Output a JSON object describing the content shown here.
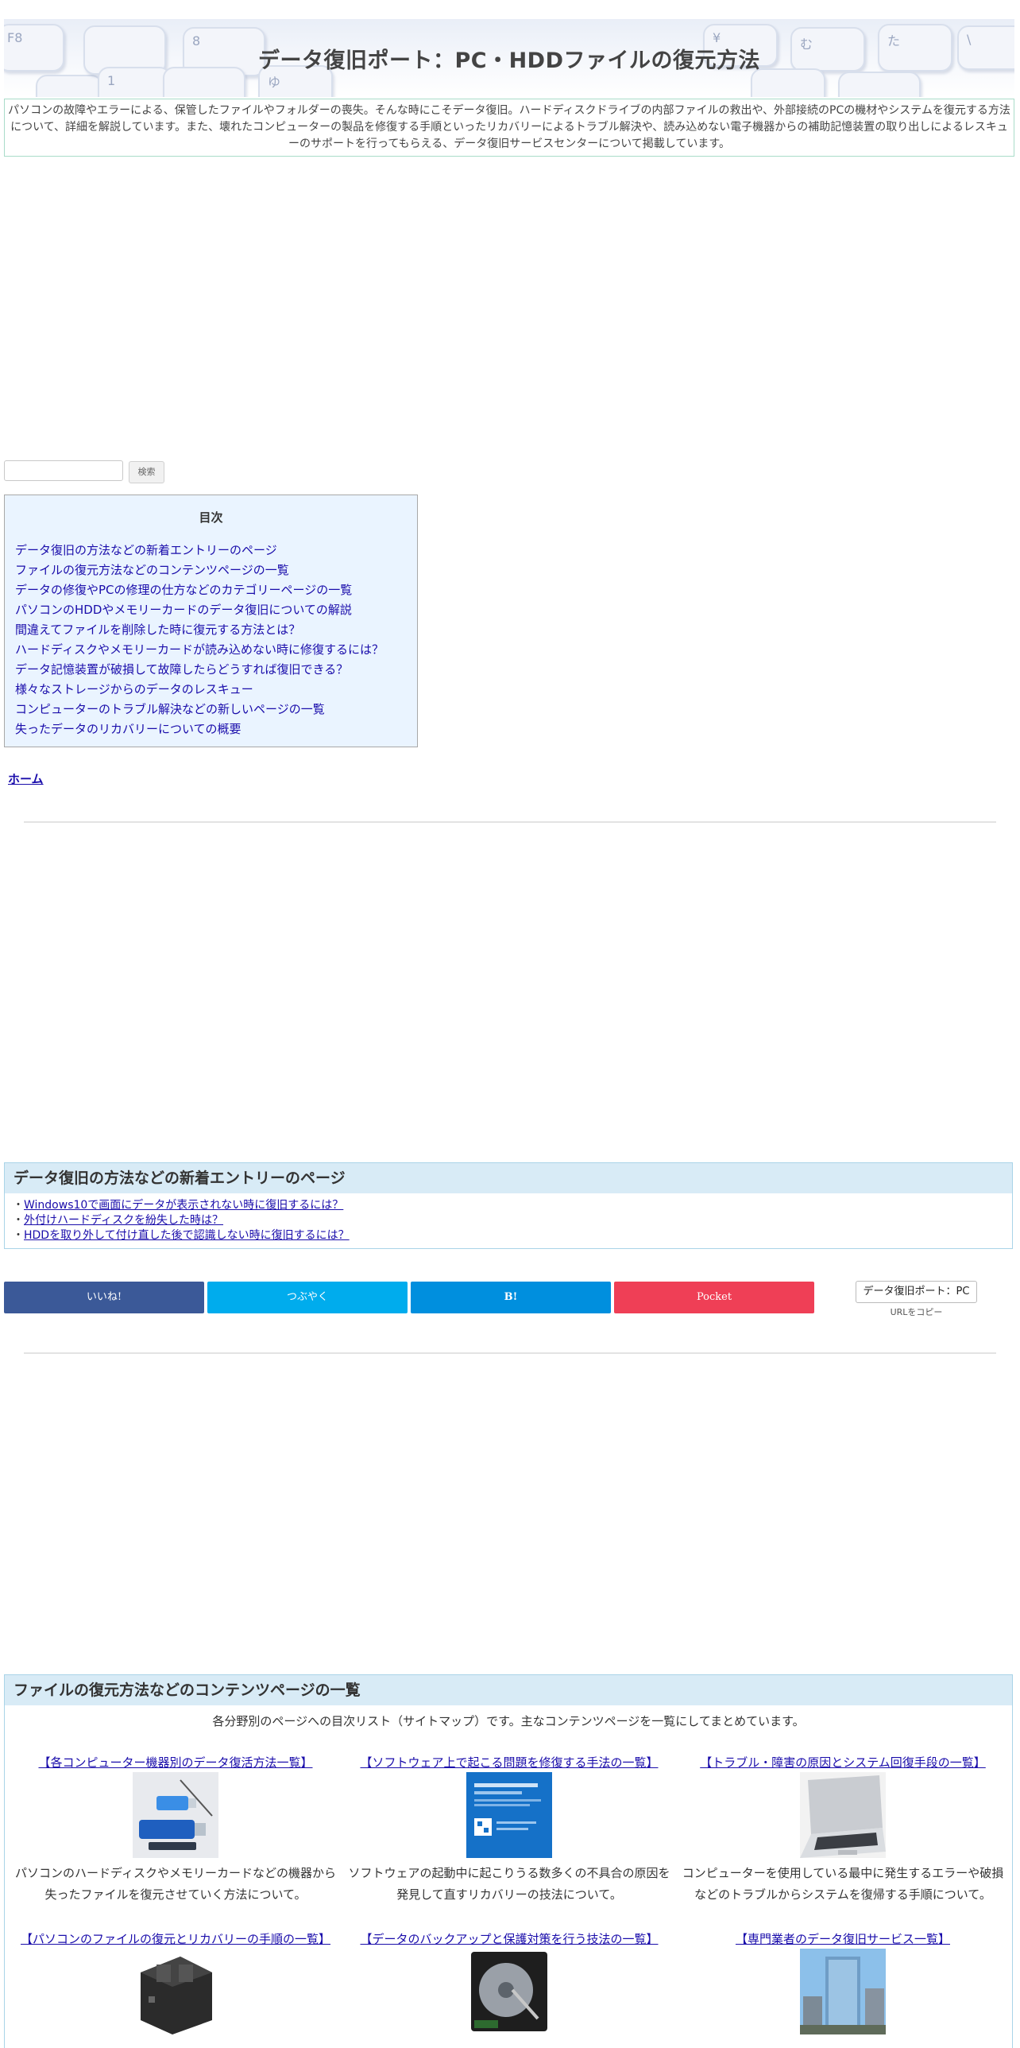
{
  "header": {
    "site_title": "データ復旧ポート：PC・HDDファイルの復元方法",
    "description": "パソコンの故障やエラーによる、保管したファイルやフォルダーの喪失。そんな時にこそデータ復旧。ハードディスクドライブの内部ファイルの救出や、外部接続のPCの機材やシステムを復元する方法について、詳細を解説しています。また、壊れたコンピューターの製品を修復する手順といったリカバリーによるトラブル解決や、読み込めない電子機器からの補助記憶装置の取り出しによるレスキューのサポートを行ってもらえる、データ復旧サービスセンターについて掲載しています。",
    "keyboard_keys": [
      "F8",
      "8",
      "ゆ",
      "¥",
      "む",
      "た",
      "1",
      "\\"
    ]
  },
  "search": {
    "input_value": "",
    "button_label": "検索"
  },
  "toc": {
    "title": "目次",
    "items": [
      "データ復旧の方法などの新着エントリーのページ",
      "ファイルの復元方法などのコンテンツページの一覧",
      "データの修復やPCの修理の仕方などのカテゴリーページの一覧",
      "パソコンのHDDやメモリーカードのデータ復旧についての解説",
      "間違えてファイルを削除した時に復元する方法とは？",
      "ハードディスクやメモリーカードが読み込めない時に修復するには？",
      "データ記憶装置が破損して故障したらどうすれば復旧できる？",
      "様々なストレージからのデータのレスキュー",
      "コンピューターのトラブル解決などの新しいページの一覧",
      "失ったデータのリカバリーについての概要"
    ]
  },
  "breadcrumb": {
    "home_label": "ホーム"
  },
  "new_entries": {
    "heading": "データ復旧の方法などの新着エントリーのページ",
    "bullet": "・",
    "items": [
      "Windows10で画面にデータが表示されない時に復旧するには？",
      "外付けハードディスクを紛失した時は？",
      "HDDを取り外して付け直した後で認識しない時に復旧するには？"
    ]
  },
  "share": {
    "facebook_label": "いいね!",
    "twitter_label": "つぶやく",
    "hatena_label": "B!",
    "pocket_label": "Pocket",
    "copy_text": "データ復旧ポート：PC",
    "copy_label": "URLをコピー",
    "colors": {
      "facebook": "#3b5998",
      "twitter": "#00aced",
      "hatena": "#008fde",
      "pocket": "#ef3f56"
    }
  },
  "sitemap": {
    "heading": "ファイルの復元方法などのコンテンツページの一覧",
    "intro": "各分野別のページへの目次リスト（サイトマップ）です。主なコンテンツページを一覧にしてまとめています。",
    "cards": [
      {
        "title": "【各コンピューター機器別のデータ復活方法一覧】",
        "image": "usb-memory-devices",
        "desc": "パソコンのハードディスクやメモリーカードなどの機器から失ったファイルを復元させていく方法について。"
      },
      {
        "title": "【ソフトウェア上で起こる問題を修復する手法の一覧】",
        "image": "blue-screen-error",
        "desc": "ソフトウェアの起動中に起こりうる数多くの不具合の原因を発見して直すリカバリーの技法について。"
      },
      {
        "title": "【トラブル・障害の原因とシステム回復手段の一覧】",
        "image": "laptop-computer",
        "desc": "コンピューターを使用している最中に発生するエラーや破損などのトラブルからシステムを復帰する手順について。"
      },
      {
        "title": "【パソコンのファイルの復元とリカバリーの手順の一覧】",
        "image": "hdd-dock",
        "desc": ""
      },
      {
        "title": "【データのバックアップと保護対策を行う技法の一覧】",
        "image": "opened-hard-disk",
        "desc": ""
      },
      {
        "title": "【専門業者のデータ復旧サービス一覧】",
        "image": "office-building",
        "desc": ""
      }
    ]
  }
}
